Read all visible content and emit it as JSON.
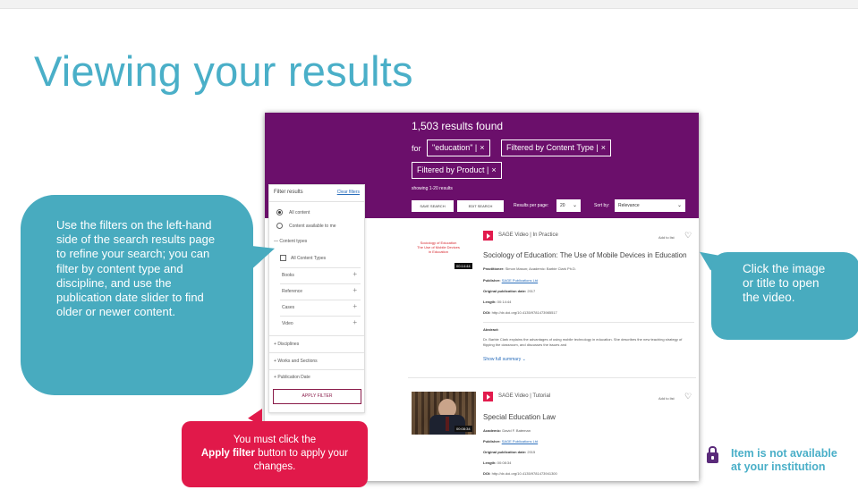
{
  "slide": {
    "title": "Viewing your results"
  },
  "header": {
    "results_count": "1,503 results found",
    "for_label": "for",
    "chips": [
      {
        "label": "\"education\" |",
        "close": "×"
      },
      {
        "label": "Filtered by Content Type |",
        "close": "×"
      },
      {
        "label": "Filtered by Product |",
        "close": "×"
      }
    ],
    "showing": "showing 1-20 results",
    "save_search": "SAVE SEARCH",
    "edit_search": "EDIT SEARCH",
    "results_per_page_label": "Results per page:",
    "results_per_page_value": "20",
    "sort_label": "Sort by:",
    "sort_value": "Relevance"
  },
  "filters": {
    "title": "Filter results",
    "clear": "Clear filters",
    "all_content": "All content",
    "available": "Content available to me",
    "content_types": "Content types",
    "all_content_types": "All Content Types",
    "types": [
      "Books",
      "Reference",
      "Cases",
      "Video"
    ],
    "disciplines": "Disciplines",
    "works": "Works and Sections",
    "pub_date": "Publication Date",
    "apply": "APPLY FILTER"
  },
  "results": [
    {
      "source": "SAGE Video | In Practice",
      "add_to_list": "Add to list",
      "title": "Sociology of Education: The Use of Mobile Devices in Education",
      "thumb_text": "Sociology of Education\nThe Use of Mobile Devices\nin Education",
      "duration": "00:14:44",
      "practitioner": "Practitioner:",
      "practitioner_value": "Simon Mason; Academic:  Barbie Clark Ph.D.",
      "publisher": "Publisher:",
      "publisher_value": "SAGE Publications Ltd",
      "orig_pub": "Original publication date:",
      "orig_pub_value": "2017",
      "length": "Length:",
      "length_value": "00:14:44",
      "doi": "DOI:",
      "doi_value": "http://dx.doi.org/10.4135/9781473985517",
      "abstract_label": "Abstract:",
      "abstract": "Dr. Barbie Clark explains the advantages of using mobile technology in education. She describes the new teaching strategy of flipping the classroom, and discusses the issues and",
      "show_more": "Show full summary"
    },
    {
      "source": "SAGE Video | Tutorial",
      "add_to_list": "Add to list",
      "title": "Special Education Law",
      "duration": "00:08:34",
      "academic": "Academic:",
      "academic_value": "David F. Bateman",
      "publisher": "Publisher:",
      "publisher_value": "SAGE Publications Ltd",
      "orig_pub": "Original publication date:",
      "orig_pub_value": "2015",
      "length": "Length:",
      "length_value": "00:08:34",
      "doi": "DOI:",
      "doi_value": "http://dx.doi.org/10.4135/9781473941300"
    }
  ],
  "callouts": {
    "filters": "Use the filters on the left-hand side of the search results page to refine your search; you can filter by content type and discipline, and use the publication date slider to find older or newer content.",
    "click_image": "Click the image or title to open the video.",
    "apply_prefix": "You must click the",
    "apply_bold": "Apply filter",
    "apply_suffix": " button to apply your changes.",
    "not_available_1": "Item is not available",
    "not_available_2": "at your institution"
  },
  "colors": {
    "header_purple": "#6b0f6b",
    "title_teal": "#4aafc8",
    "callout_blue": "#48abbf",
    "callout_red": "#e1194a",
    "play_red": "#e21b4d"
  }
}
